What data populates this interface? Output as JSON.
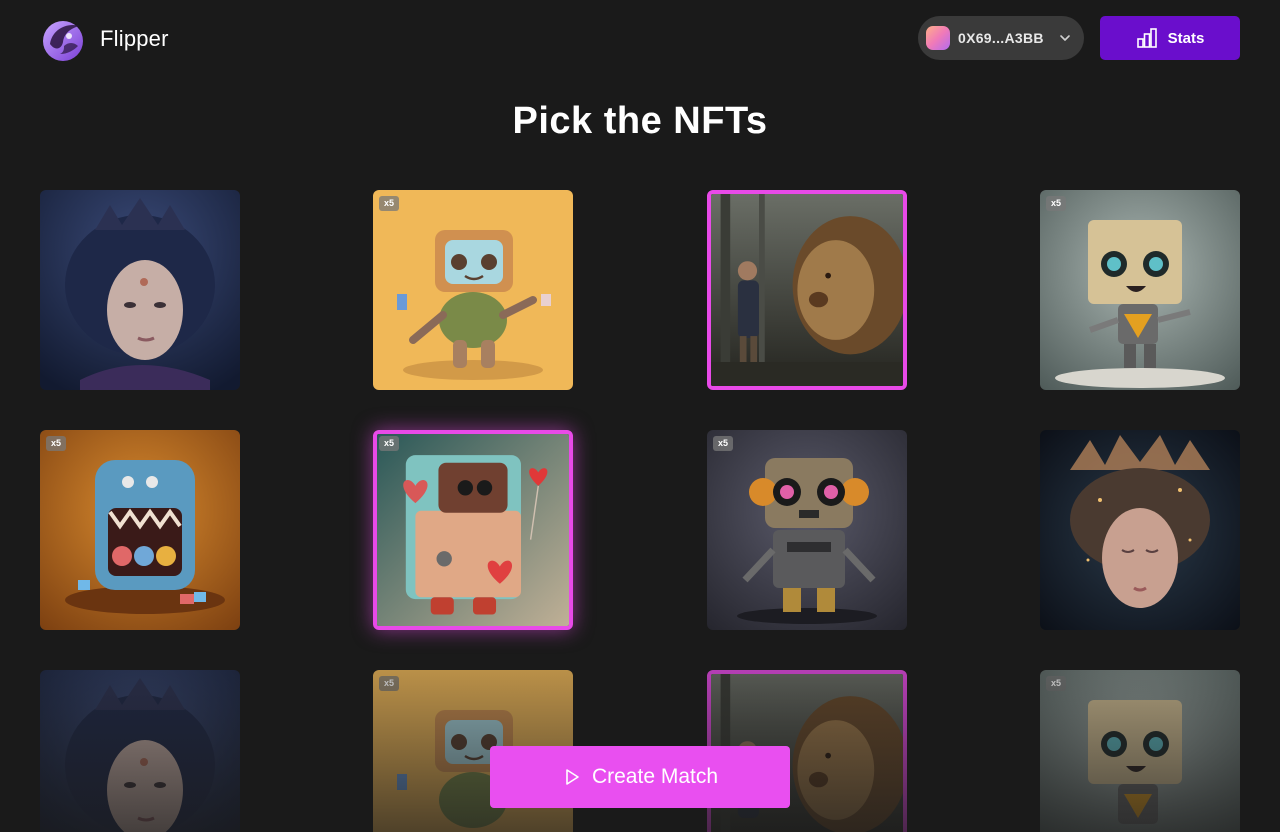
{
  "brand": {
    "name": "Flipper",
    "logo_icon": "flipper-logo-icon"
  },
  "wallet": {
    "address": "0X69...A3BB",
    "avatar": "wallet-avatar-gradient",
    "chevron_icon": "chevron-down-icon"
  },
  "stats_button": {
    "label": "Stats",
    "icon": "bar-chart-icon"
  },
  "page_title": "Pick the NFTs",
  "nft_grid": [
    {
      "art": "queen-portrait",
      "badge": "",
      "selected": false
    },
    {
      "art": "yellow-robot",
      "badge": "x5",
      "selected": false
    },
    {
      "art": "lion-and-boy",
      "badge": "",
      "selected": true
    },
    {
      "art": "box-robot",
      "badge": "x5",
      "selected": false
    },
    {
      "art": "blue-monster-machine",
      "badge": "x5",
      "selected": false
    },
    {
      "art": "heart-robot",
      "badge": "x5",
      "selected": true
    },
    {
      "art": "headphone-robot",
      "badge": "x5",
      "selected": false
    },
    {
      "art": "crowned-girl",
      "badge": "",
      "selected": false
    },
    {
      "art": "queen-portrait",
      "badge": "",
      "selected": false
    },
    {
      "art": "yellow-robot",
      "badge": "x5",
      "selected": false
    },
    {
      "art": "lion-and-boy",
      "badge": "",
      "selected": true
    },
    {
      "art": "box-robot",
      "badge": "x5",
      "selected": false
    }
  ],
  "create_button": {
    "label": "Create Match",
    "icon": "play-icon"
  },
  "colors": {
    "background": "#1a1a1a",
    "accent_purple": "#6a0ecc",
    "accent_pink": "#e94ff0",
    "selection_border": "#e84ae8",
    "wallet_pill": "#3a3a3a"
  }
}
